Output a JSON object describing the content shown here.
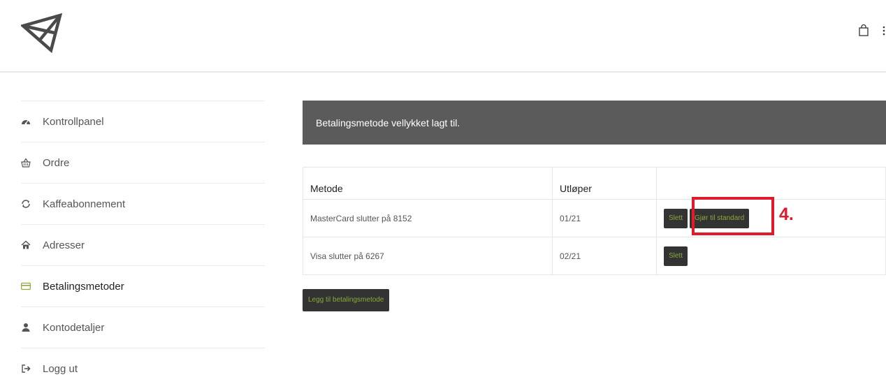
{
  "header": {
    "logo_icon": "triangle-logo-icon",
    "cart_icon": "shopping-bag-icon",
    "menu_icon": "menu-icon"
  },
  "sidebar": {
    "items": [
      {
        "label": "Kontrollpanel",
        "icon": "dashboard-icon"
      },
      {
        "label": "Ordre",
        "icon": "basket-icon"
      },
      {
        "label": "Kaffeabonnement",
        "icon": "refresh-icon"
      },
      {
        "label": "Adresser",
        "icon": "home-icon"
      },
      {
        "label": "Betalingsmetoder",
        "icon": "credit-card-icon",
        "active": true
      },
      {
        "label": "Kontodetaljer",
        "icon": "user-icon"
      },
      {
        "label": "Logg ut",
        "icon": "logout-icon"
      }
    ]
  },
  "notice": {
    "message": "Betalingsmetode vellykket lagt til."
  },
  "table": {
    "headers": [
      "Metode",
      "Utløper",
      ""
    ],
    "rows": [
      {
        "method": "MasterCard slutter på 8152",
        "expires": "01/21",
        "delete_label": "Slett",
        "default_label": "Gjør til standard"
      },
      {
        "method": "Visa slutter på 6267",
        "expires": "02/21",
        "delete_label": "Slett"
      }
    ]
  },
  "add_button_label": "Legg til betalingsmetode",
  "annotation": {
    "step_label": "4.",
    "color": "#e0192b"
  },
  "colors": {
    "button_bg": "#333333",
    "button_text": "#8ba83a",
    "notice_bg": "#5b5b5b"
  }
}
